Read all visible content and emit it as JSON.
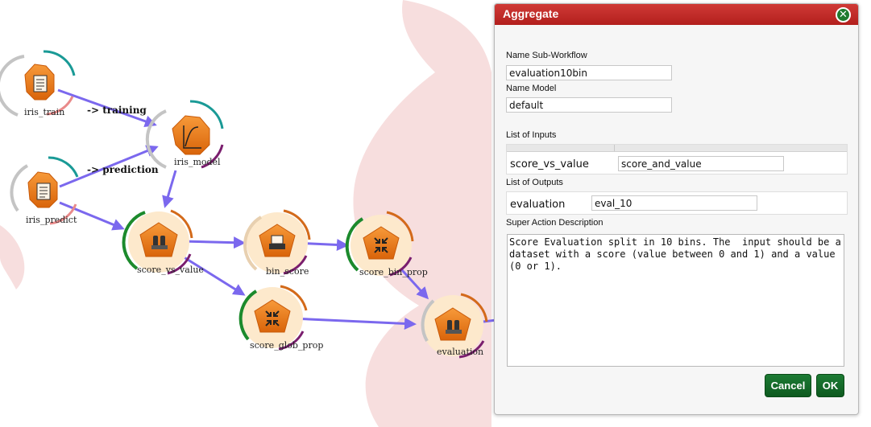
{
  "workflow": {
    "nodes": [
      {
        "id": "iris_train",
        "label": "iris_train",
        "icon": "document-icon"
      },
      {
        "id": "iris_predict",
        "label": "iris_predict",
        "icon": "document-icon"
      },
      {
        "id": "iris_model",
        "label": "iris_model",
        "icon": "model-curve-icon"
      },
      {
        "id": "score_vs_value",
        "label": "score_vs_value",
        "icon": "database-icon"
      },
      {
        "id": "bin_score",
        "label": "bin_score",
        "icon": "printer-icon"
      },
      {
        "id": "score_bin_prop",
        "label": "score_bin_prop",
        "icon": "collapse-arrows-icon"
      },
      {
        "id": "score_glob_prop",
        "label": "score_glob_prop",
        "icon": "collapse-arrows-icon"
      },
      {
        "id": "evaluation",
        "label": "evaluation",
        "icon": "database-icon"
      }
    ],
    "edge_labels": {
      "training": "-> training",
      "prediction": "-> prediction"
    },
    "colors": {
      "edge": "#7b68ee",
      "node_orange": "#ef7d0e",
      "node_halo": "#fde9cc",
      "ring_teal": "#1a9a96",
      "ring_green": "#1c8a2c",
      "ring_purple": "#7a1e6e",
      "ring_orange": "#d36a1a",
      "ring_pink": "#e98a8a",
      "ring_grey": "#c4c4c4"
    }
  },
  "dialog": {
    "title": "Aggregate",
    "close_symbol": "✕",
    "name_subworkflow_label": "Name Sub-Workflow",
    "name_subworkflow_value": "evaluation10bin",
    "name_model_label": "Name Model",
    "name_model_value": "default",
    "inputs_label": "List of Inputs",
    "inputs": [
      {
        "name": "score_vs_value",
        "value": "score_and_value"
      }
    ],
    "outputs_label": "List of Outputs",
    "outputs": [
      {
        "name": "evaluation",
        "value": "eval_10"
      }
    ],
    "description_label": "Super Action Description",
    "description": "Score Evaluation split in 10 bins. The  input should be a dataset with a score (value between 0 and 1) and a value (0 or 1).",
    "cancel_label": "Cancel",
    "ok_label": "OK",
    "colors": {
      "header": "#c0282a",
      "button": "#146b2a"
    }
  }
}
